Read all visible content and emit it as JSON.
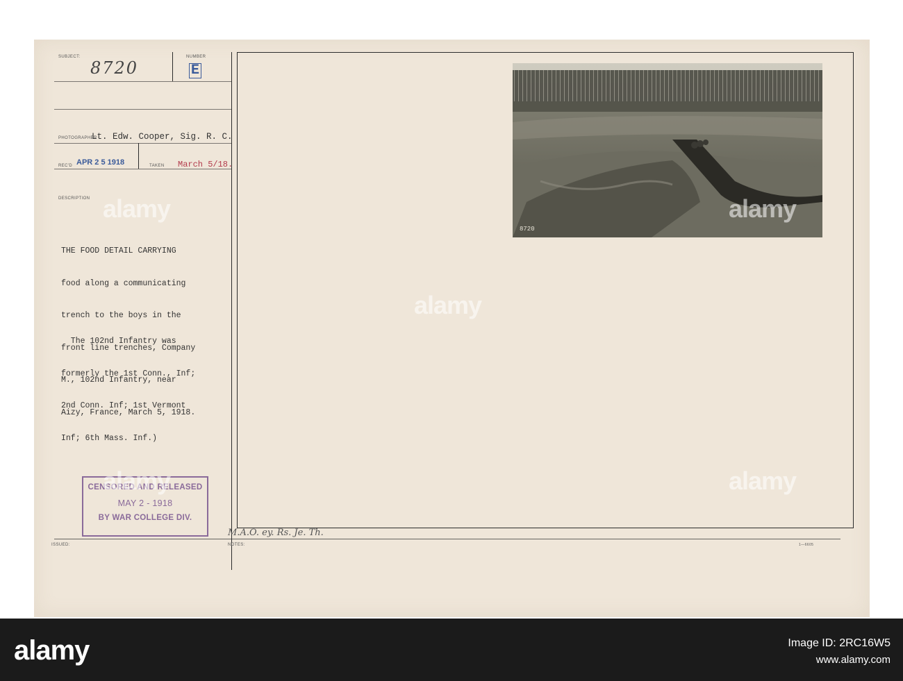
{
  "card": {
    "subject_label": "SUBJECT:",
    "subject_value": "8720",
    "number_label": "NUMBER",
    "number_value": "E",
    "photographer_label": "PHOTOGRAPHER",
    "photographer_value": "Lt. Edw. Cooper, Sig. R. C.",
    "recd_label": "REC'D",
    "recd_value": "APR 2 5 1918",
    "taken_label": "TAKEN",
    "taken_value": "March 5/18.",
    "description_label": "DESCRIPTION",
    "description_lines": [
      "THE FOOD DETAIL CARRYING",
      "food along a communicating",
      "trench to the boys in the",
      "front line trenches, Company",
      "M., 102nd Infantry, near",
      "Aizy, France, March 5, 1918."
    ],
    "note_lines": [
      "  The 102nd Infantry was",
      "formerly the 1st Conn., Inf;",
      "2nd Conn. Inf; 1st Vermont",
      "Inf; 6th Mass. Inf.)"
    ],
    "stamp_lines": [
      "CENSORED AND RELEASED",
      "MAY 2 - 1918",
      "BY WAR COLLEGE DIV."
    ],
    "issued_label": "ISSUED:",
    "notes_label": "NOTES:",
    "notes_value": "M.A.O. ey. Rs. Je. Th.",
    "form_code": "1—6605",
    "photo_number": "8720"
  },
  "watermark": "alamy",
  "footer": {
    "logo": "alamy",
    "image_id_line": "Image ID: 2RC16W5",
    "url": "www.alamy.com"
  }
}
